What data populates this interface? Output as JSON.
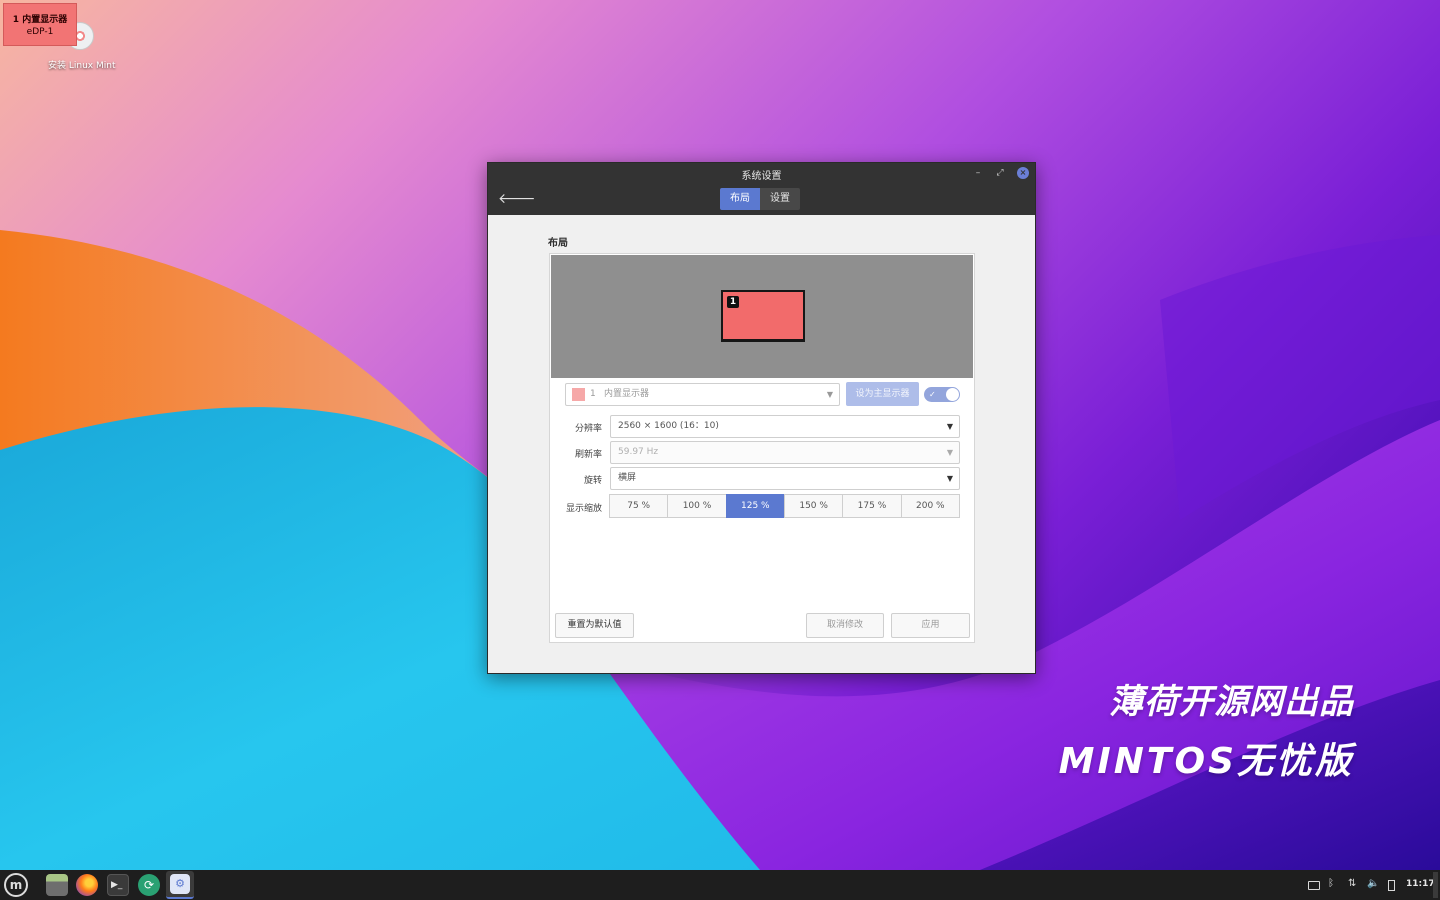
{
  "osd": {
    "number": "1",
    "name": "内置显示器",
    "connector": "eDP-1"
  },
  "desktop": {
    "icons": [
      {
        "label": "安装 Linux Mint",
        "icon": "dvd-disc-icon"
      }
    ],
    "watermark": {
      "line1": "薄荷开源网出品",
      "line2": "MINTOS无忧版"
    }
  },
  "window": {
    "title": "系统设置",
    "tabs": [
      {
        "label": "布局",
        "active": true
      },
      {
        "label": "设置",
        "active": false
      }
    ],
    "section_title": "布局",
    "monitor_tile": {
      "number": "1",
      "color": "#f26b6b"
    },
    "monitor_select": {
      "number": "1",
      "name": "内置显示器",
      "swatch_color": "#f6a8a8"
    },
    "set_primary_label": "设为主显示器",
    "enabled_toggle": true,
    "fields": {
      "resolution": {
        "label": "分辨率",
        "value": "2560 × 1600 (16：10)"
      },
      "refresh_rate": {
        "label": "刷新率",
        "value": "59.97 Hz"
      },
      "rotation": {
        "label": "旋转",
        "value": "横屏"
      },
      "scale": {
        "label": "显示缩放",
        "options": [
          "75 %",
          "100 %",
          "125 %",
          "150 %",
          "175 %",
          "200 %"
        ],
        "selected": "125 %"
      }
    },
    "buttons": {
      "reset": "重置为默认值",
      "cancel": "取消修改",
      "apply": "应用"
    }
  },
  "taskbar": {
    "launchers": [
      "mint-menu-icon",
      "files-icon",
      "firefox-icon",
      "terminal-icon",
      "update-manager-icon",
      "system-settings-icon"
    ],
    "tray": [
      "keyboard-icon",
      "bluetooth-icon",
      "network-icon",
      "volume-icon",
      "battery-icon"
    ],
    "clock": "11:17"
  },
  "colors": {
    "accent": "#5b79d0",
    "titlebar": "#333333",
    "taskbar": "#1e1e1e"
  }
}
